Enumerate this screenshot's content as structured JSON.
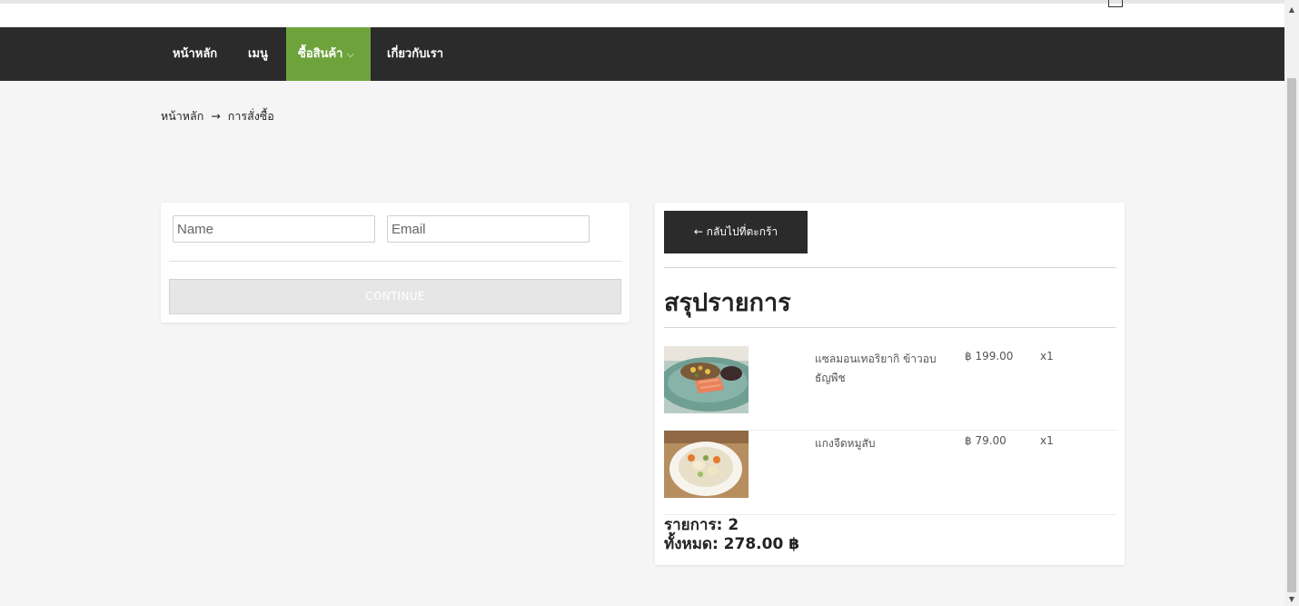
{
  "topbar": {
    "cart_icon": "shopping-bag-icon"
  },
  "nav": {
    "items": [
      {
        "label": "หน้าหลัก",
        "active": false
      },
      {
        "label": "เมนู",
        "active": false
      },
      {
        "label": "ซื้อสินค้า",
        "active": true,
        "has_dropdown": true
      },
      {
        "label": "เกี่ยวกับเรา",
        "active": false
      }
    ],
    "chevron": "⌵"
  },
  "breadcrumb": {
    "home": "หน้าหลัก",
    "separator": "→",
    "current": "การสั่งซื้อ"
  },
  "form": {
    "name_placeholder": "Name",
    "email_placeholder": "Email",
    "name_value": "",
    "email_value": "",
    "continue_label": "CONTINUE"
  },
  "summary": {
    "back_label": "← กลับไปที่ตะกร้า",
    "title": "สรุปรายการ",
    "items": [
      {
        "name": "แซลมอนเทอริยากิ ข้าวอบธัญพืช",
        "price": "฿ 199.00",
        "qty": "x1"
      },
      {
        "name": "แกงจืดหมูสับ",
        "price": "฿ 79.00",
        "qty": "x1"
      }
    ],
    "count_text": "รายการ: 2",
    "total_text": "ทั้งหมด: 278.00 ฿"
  },
  "colors": {
    "nav_bg": "#2b2b2b",
    "nav_active": "#6ea33c",
    "page_bg": "#f5f5f5"
  }
}
